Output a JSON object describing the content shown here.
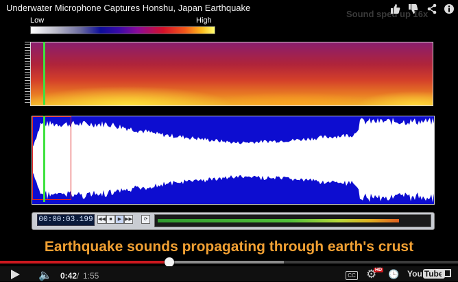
{
  "video": {
    "title": "Underwater Microphone Captures Honshu, Japan Earthquake",
    "speed_note": "Sound sped up 16x",
    "caption": "Earthquake sounds propagating through earth's crust"
  },
  "top_actions": {
    "like_icon": "thumbs-up-icon",
    "dislike_icon": "thumbs-down-icon",
    "share_icon": "share-icon",
    "info_icon": "info-icon"
  },
  "legend": {
    "low": "Low",
    "high": "High"
  },
  "analyzer": {
    "timecode": "00:00:03.199",
    "buttons": [
      "rewind",
      "stop",
      "play",
      "fast-forward",
      "loop"
    ]
  },
  "player": {
    "progress_fraction": 0.37,
    "buffered_fraction": 0.62,
    "time_current": "0:42",
    "time_separator": "/",
    "time_total": "1:55",
    "hd_badge": "HD",
    "cc_label": "CC",
    "logo_you": "You",
    "logo_tube": "Tube"
  },
  "colors": {
    "caption": "#f1a033",
    "progress_played": "#cc181e",
    "waveform_bg": "#0d0dd0",
    "marker": "#3fe23f"
  }
}
